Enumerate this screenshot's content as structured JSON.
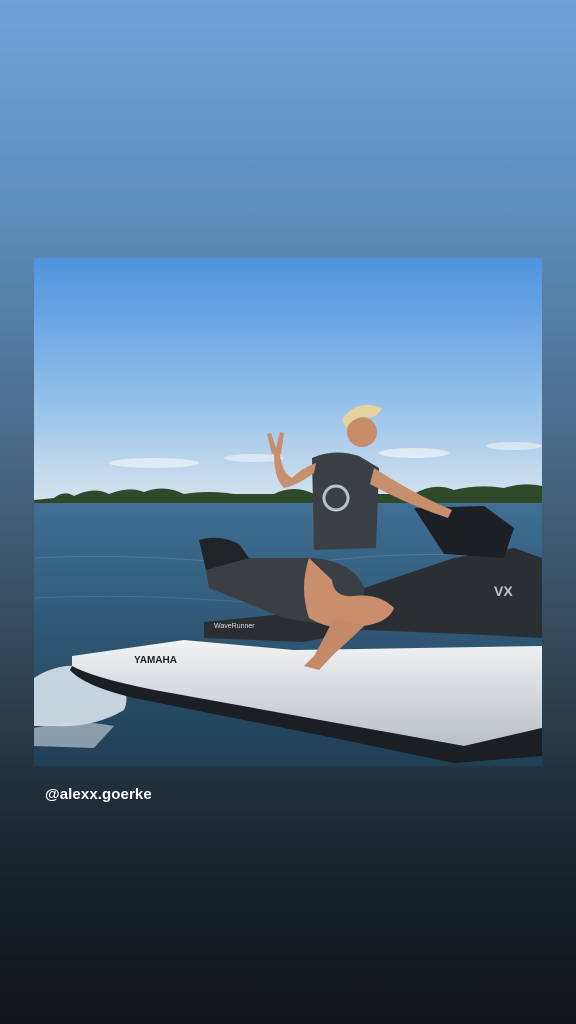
{
  "story": {
    "background_top_color": "#6fa3d8",
    "background_bottom_color": "#0f1418",
    "photo": {
      "icon": "photo-image",
      "brand_text": "YAMAHA",
      "model_text": "WaveRunner",
      "badge_text": "VX"
    },
    "mention_text": "@alexx.goerke"
  }
}
